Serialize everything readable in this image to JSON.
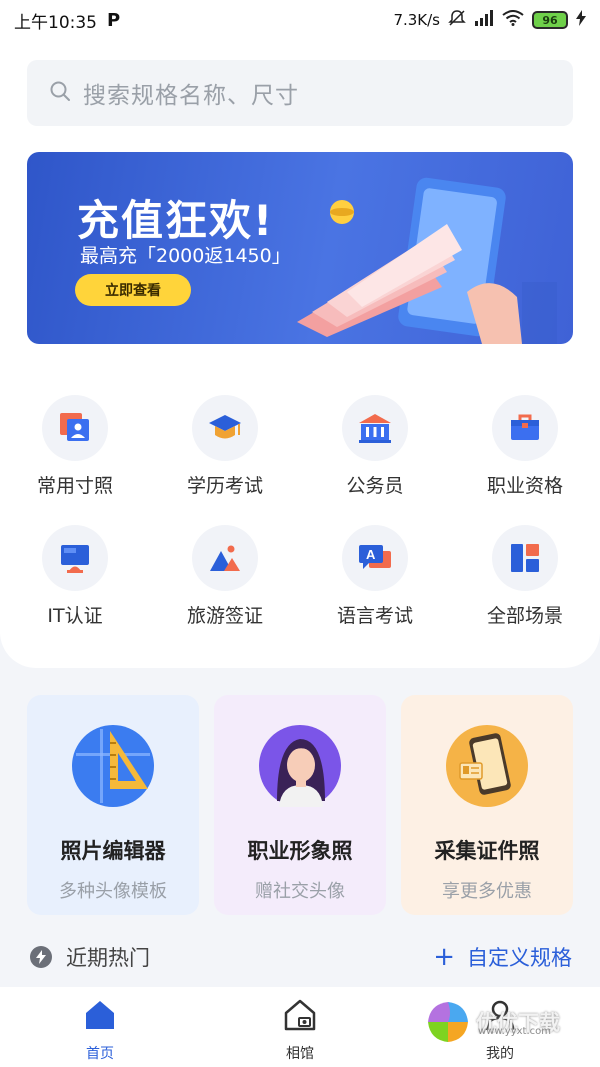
{
  "status_bar": {
    "time": "上午10:35",
    "app_icon": "P",
    "speed": "7.3K/s",
    "battery": "96"
  },
  "search": {
    "placeholder": "搜索规格名称、尺寸"
  },
  "banner": {
    "title": "充值狂欢!",
    "subtitle": "最高充「2000返1450」",
    "button": "立即查看"
  },
  "categories": [
    {
      "label": "常用寸照",
      "icon": "id-photo-icon"
    },
    {
      "label": "学历考试",
      "icon": "graduation-cap-icon"
    },
    {
      "label": "公务员",
      "icon": "government-building-icon"
    },
    {
      "label": "职业资格",
      "icon": "briefcase-icon"
    },
    {
      "label": "IT认证",
      "icon": "monitor-icon"
    },
    {
      "label": "旅游签证",
      "icon": "mountain-icon"
    },
    {
      "label": "语言考试",
      "icon": "language-chat-icon"
    },
    {
      "label": "全部场景",
      "icon": "grid-icon"
    }
  ],
  "features": [
    {
      "title": "照片编辑器",
      "subtitle": "多种头像模板",
      "icon": "ruler-triangle-icon",
      "bg": "#e8f0fd"
    },
    {
      "title": "职业形象照",
      "subtitle": "赠社交头像",
      "icon": "woman-portrait-icon",
      "bg": "#f4ecfb"
    },
    {
      "title": "采集证件照",
      "subtitle": "享更多优惠",
      "icon": "phone-card-icon",
      "bg": "#fdf0e4"
    }
  ],
  "hot": {
    "label": "近期热门"
  },
  "custom": {
    "label": "自定义规格"
  },
  "tabs": [
    {
      "label": "首页",
      "icon": "home-icon"
    },
    {
      "label": "相馆",
      "icon": "studio-icon"
    },
    {
      "label": "我的",
      "icon": "user-icon"
    }
  ],
  "watermark": {
    "text": "优优下载",
    "sub": "www.yyxt.com"
  },
  "colors": {
    "accent": "#2b5fd9",
    "banner_button": "#ffd43a"
  }
}
